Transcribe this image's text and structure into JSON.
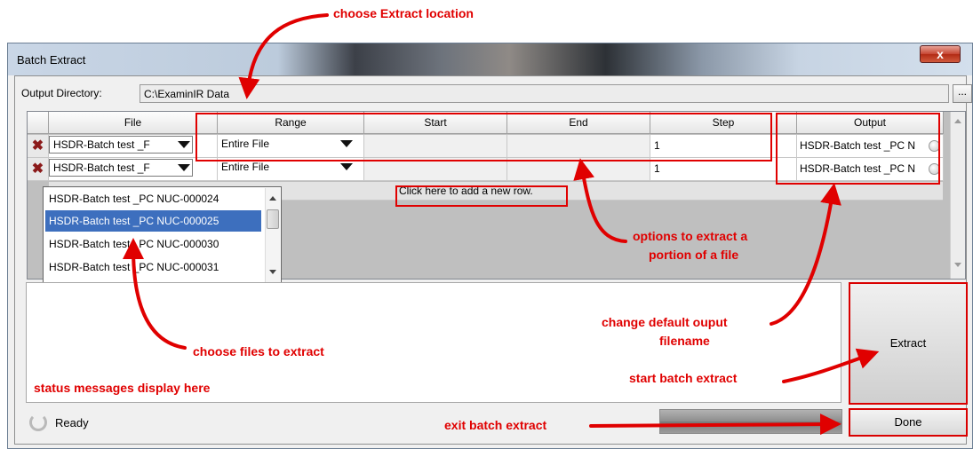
{
  "window": {
    "title": "Batch Extract",
    "close_label": "x"
  },
  "output": {
    "label": "Output Directory:",
    "value": "C:\\ExaminIR Data",
    "browse_label": "..."
  },
  "grid": {
    "headers": [
      "File",
      "Range",
      "Start",
      "End",
      "Step",
      "Output"
    ],
    "rows": [
      {
        "file": "HSDR-Batch test _F",
        "range": "Entire File",
        "start": "",
        "end": "",
        "step": "1",
        "output": "HSDR-Batch test _PC N"
      },
      {
        "file": "HSDR-Batch test _F",
        "range": "Entire File",
        "start": "",
        "end": "",
        "step": "1",
        "output": "HSDR-Batch test _PC N"
      }
    ],
    "add_row_label": "Click here to add a new row.",
    "delete_icon": "red-x-icon"
  },
  "dropdown": {
    "options": [
      "HSDR-Batch test _PC NUC-000024",
      "HSDR-Batch test _PC NUC-000025",
      "HSDR-Batch test _PC NUC-000030",
      "HSDR-Batch test _PC NUC-000031"
    ],
    "selected_index": 1
  },
  "buttons": {
    "extract": "Extract",
    "done": "Done"
  },
  "status": {
    "text": "Ready"
  },
  "annotations": {
    "choose_location": "choose Extract location",
    "options_line1": "options to extract a",
    "options_line2": "portion of a file",
    "choose_files": "choose files to extract",
    "change_output_line1": "change default ouput",
    "change_output_line2": "filename",
    "start_batch": "start batch extract",
    "status_messages": "status messages display here",
    "exit_batch": "exit batch extract"
  },
  "colors": {
    "annotation": "#e00000",
    "selection": "#3d6fbe"
  }
}
